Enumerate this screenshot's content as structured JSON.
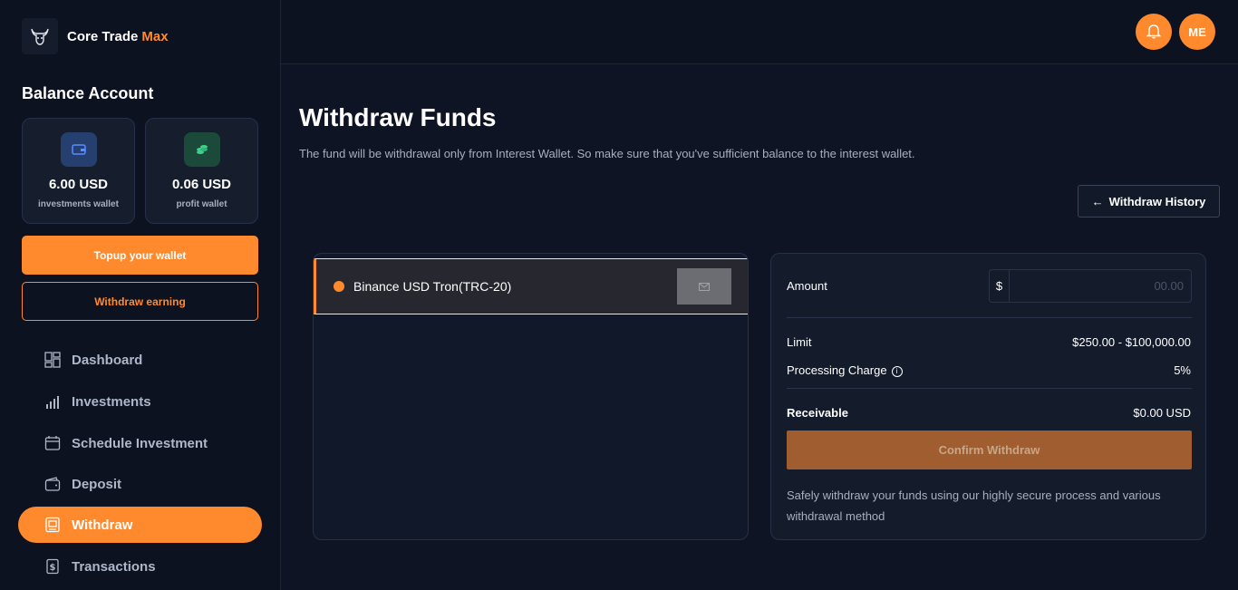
{
  "brand": {
    "name": "Core Trade",
    "accent": "Max",
    "logo_icon": "bull-head-icon"
  },
  "sidebar": {
    "section_title": "Balance Account",
    "wallets": [
      {
        "amount": "6.00 USD",
        "label": "investments wallet",
        "icon": "wallet-icon"
      },
      {
        "amount": "0.06 USD",
        "label": "profit wallet",
        "icon": "coins-icon"
      }
    ],
    "topup_label": "Topup your wallet",
    "withdraw_earning_label": "Withdraw earning",
    "nav": [
      {
        "label": "Dashboard",
        "icon": "dashboard-icon",
        "active": false
      },
      {
        "label": "Investments",
        "icon": "investments-icon",
        "active": false
      },
      {
        "label": "Schedule Investment",
        "icon": "calendar-icon",
        "active": false
      },
      {
        "label": "Deposit",
        "icon": "deposit-wallet-icon",
        "active": false
      },
      {
        "label": "Withdraw",
        "icon": "withdraw-icon",
        "active": true
      },
      {
        "label": "Transactions",
        "icon": "transactions-icon",
        "active": false
      }
    ]
  },
  "topbar": {
    "notification_icon": "bell-icon",
    "avatar_initials": "ME"
  },
  "main": {
    "title": "Withdraw Funds",
    "subtitle": "The fund will be withdrawal only from Interest Wallet. So make sure that you've sufficient balance to the interest wallet.",
    "history_label": "Withdraw History",
    "history_arrow": "←",
    "method": {
      "name": "Binance USD Tron(TRC-20)"
    },
    "form": {
      "amount_label": "Amount",
      "currency_symbol": "$",
      "amount_placeholder": "00.00",
      "limit_label": "Limit",
      "limit_value": "$250.00 - $100,000.00",
      "charge_label": "Processing Charge",
      "charge_value": "5%",
      "receivable_label": "Receivable",
      "receivable_value": "$0.00 USD",
      "confirm_label": "Confirm Withdraw",
      "note": "Safely withdraw your funds using our highly secure process and various withdrawal method"
    }
  },
  "colors": {
    "accent": "#ff8a2e",
    "background": "#0e1423",
    "panel": "#141c2c"
  }
}
